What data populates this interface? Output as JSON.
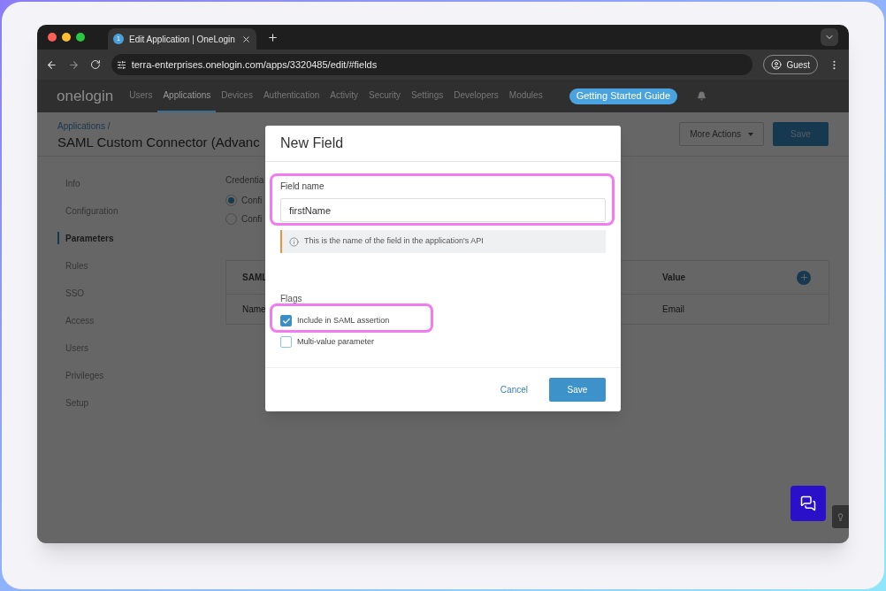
{
  "browser": {
    "tab_badge": "1",
    "tab_title": "Edit Application | OneLogin",
    "url": "terra-enterprises.onelogin.com/apps/3320485/edit/#fields",
    "profile": "Guest"
  },
  "nav": {
    "logo": "onelogin",
    "items": [
      {
        "label": "Users",
        "selected": false
      },
      {
        "label": "Applications",
        "selected": true
      },
      {
        "label": "Devices",
        "selected": false
      },
      {
        "label": "Authentication",
        "selected": false
      },
      {
        "label": "Activity",
        "selected": false
      },
      {
        "label": "Security",
        "selected": false
      },
      {
        "label": "Settings",
        "selected": false
      },
      {
        "label": "Developers",
        "selected": false
      },
      {
        "label": "Modules",
        "selected": false
      }
    ],
    "guide_button": "Getting Started Guide"
  },
  "page": {
    "breadcrumb": "Applications /",
    "title": "SAML Custom Connector (Advanc",
    "more_actions": "More Actions",
    "save": "Save"
  },
  "sidebar": {
    "items": [
      {
        "label": "Info",
        "selected": false
      },
      {
        "label": "Configuration",
        "selected": false
      },
      {
        "label": "Parameters",
        "selected": true
      },
      {
        "label": "Rules",
        "selected": false
      },
      {
        "label": "SSO",
        "selected": false
      },
      {
        "label": "Access",
        "selected": false
      },
      {
        "label": "Users",
        "selected": false
      },
      {
        "label": "Privileges",
        "selected": false
      },
      {
        "label": "Setup",
        "selected": false
      }
    ]
  },
  "credentials": {
    "label": "Credentia",
    "options": [
      {
        "label": "Confi",
        "selected": true
      },
      {
        "label": "Confi",
        "selected": false
      }
    ]
  },
  "table": {
    "columns": [
      "SAML",
      "Value"
    ],
    "rows": [
      [
        "Name",
        "Email"
      ]
    ]
  },
  "modal": {
    "title": "New Field",
    "field_label": "Field name",
    "field_value": "firstName",
    "hint": "This is the name of the field in the application's API",
    "flags_label": "Flags",
    "flags": [
      {
        "label": "Include in SAML assertion",
        "checked": true
      },
      {
        "label": "Multi-value parameter",
        "checked": false
      }
    ],
    "cancel": "Cancel",
    "save": "Save"
  }
}
